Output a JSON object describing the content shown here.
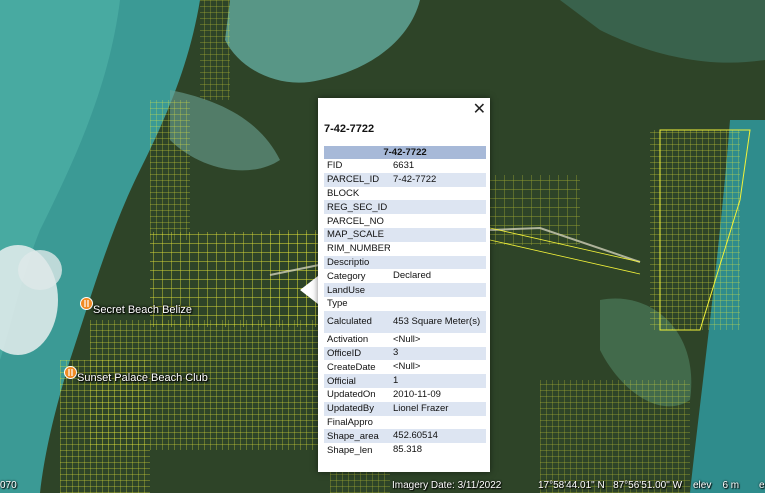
{
  "map": {
    "places": [
      {
        "name": "Secret Beach Belize",
        "icon": "restaurant-pin-icon"
      },
      {
        "name": "Sunset Palace Beach Club",
        "icon": "restaurant-pin-icon"
      }
    ],
    "colors": {
      "parcel_outline": "#f2f23a",
      "lagoon": "#4f9a8c",
      "sea": "#2f8c8c",
      "vegetation": "#2b3f25",
      "pin": "#f08a24"
    }
  },
  "status_bar": {
    "left_fragment": "070",
    "imagery_date": "Imagery Date: 3/11/2022",
    "coordinates": "17°58'44.01\" N   87°56'51.00\" W",
    "elevation": "elev    6 m",
    "right_fragment": "e"
  },
  "popup": {
    "title": "7-42-7722",
    "header": "7-42-7722",
    "rows": [
      {
        "key": "FID",
        "value": "6631"
      },
      {
        "key": "PARCEL_ID",
        "value": "7-42-7722"
      },
      {
        "key": "BLOCK",
        "value": ""
      },
      {
        "key": "REG_SEC_ID",
        "value": ""
      },
      {
        "key": "PARCEL_NO",
        "value": ""
      },
      {
        "key": "MAP_SCALE",
        "value": ""
      },
      {
        "key": "RIM_NUMBER",
        "value": ""
      },
      {
        "key": "Descriptio",
        "value": ""
      },
      {
        "key": "Category",
        "value": "Declared"
      },
      {
        "key": "LandUse",
        "value": ""
      },
      {
        "key": "Type",
        "value": ""
      },
      {
        "key": "Calculated",
        "value": "453 Square Meter(s)"
      },
      {
        "key": "Activation",
        "value": "<Null>"
      },
      {
        "key": "OfficeID",
        "value": "3"
      },
      {
        "key": "CreateDate",
        "value": "<Null>"
      },
      {
        "key": "Official",
        "value": "1"
      },
      {
        "key": "UpdatedOn",
        "value": "2010-11-09"
      },
      {
        "key": "UpdatedBy",
        "value": "Lionel Frazer"
      },
      {
        "key": "FinalAppro",
        "value": ""
      },
      {
        "key": "Shape_area",
        "value": "452.60514"
      },
      {
        "key": "Shape_len",
        "value": "85.318"
      }
    ]
  }
}
